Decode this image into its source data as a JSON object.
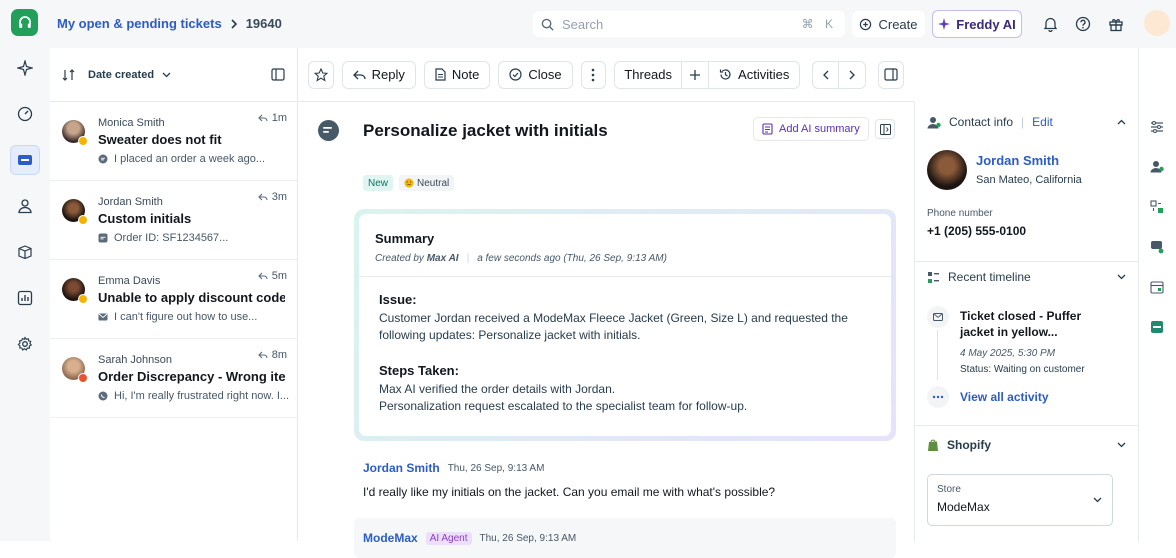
{
  "topbar": {
    "breadcrumb_link": "My open & pending tickets",
    "breadcrumb_current": "19640",
    "search_placeholder": "Search",
    "search_shortcut": "⌘ K",
    "create_label": "Create",
    "freddy_label": "Freddy AI",
    "brand_color": "#22a05b"
  },
  "ticket_list": {
    "sort_label": "Date created",
    "tickets": [
      {
        "name": "Monica Smith",
        "subject": "Sweater does not fit",
        "preview": "I placed an order a week ago...",
        "time": "1m"
      },
      {
        "name": "Jordan Smith",
        "subject": "Custom initials",
        "preview": "Order ID: SF1234567...",
        "time": "3m"
      },
      {
        "name": "Emma Davis",
        "subject": "Unable to apply discount code",
        "preview": "I can't figure out how to use...",
        "time": "5m"
      },
      {
        "name": "Sarah Johnson",
        "subject": "Order Discrepancy - Wrong ite...",
        "preview": "Hi, I'm really frustrated right now. I...",
        "time": "8m"
      }
    ]
  },
  "toolbar": {
    "reply_label": "Reply",
    "note_label": "Note",
    "close_label": "Close",
    "threads_label": "Threads",
    "activities_label": "Activities"
  },
  "ticket": {
    "subject": "Personalize jacket with initials",
    "ai_summary_label": "Add AI summary",
    "status_tag": "New",
    "sentiment_tag": "Neutral",
    "summary": {
      "title": "Summary",
      "created_by_prefix": "Created by",
      "created_by": "Max AI",
      "created_when": "a few seconds ago (Thu, 26 Sep, 9:13 AM)",
      "issue_heading": "Issue:",
      "issue_text": "Customer Jordan received a ModeMax Fleece Jacket (Green, Size L) and requested the following updates: Personalize jacket with initials.",
      "steps_heading": "Steps Taken:",
      "step_1": "Max AI verified the order details with Jordan.",
      "step_2": "Personalization request escalated to the specialist team for follow-up."
    },
    "messages": [
      {
        "author": "Jordan Smith",
        "date": "Thu, 26 Sep, 9:13 AM",
        "text": "I'd really like my initials on the jacket. Can you email me with what's possible?"
      },
      {
        "author": "ModeMax",
        "badge": "AI Agent",
        "date": "Thu, 26 Sep, 9:13 AM"
      }
    ]
  },
  "contact": {
    "section_title": "Contact info",
    "edit_label": "Edit",
    "name": "Jordan Smith",
    "location": "San Mateo, California",
    "phone_label": "Phone number",
    "phone": "+1 (205) 555-0100"
  },
  "timeline": {
    "section_title": "Recent timeline",
    "item_title": "Ticket closed - Puffer jacket in yellow...",
    "item_date": "4 May 2025, 5:30 PM",
    "item_status": "Status: Waiting on customer",
    "view_all_label": "View all activity"
  },
  "shopify": {
    "section_title": "Shopify",
    "store_label": "Store",
    "store_value": "ModeMax"
  }
}
